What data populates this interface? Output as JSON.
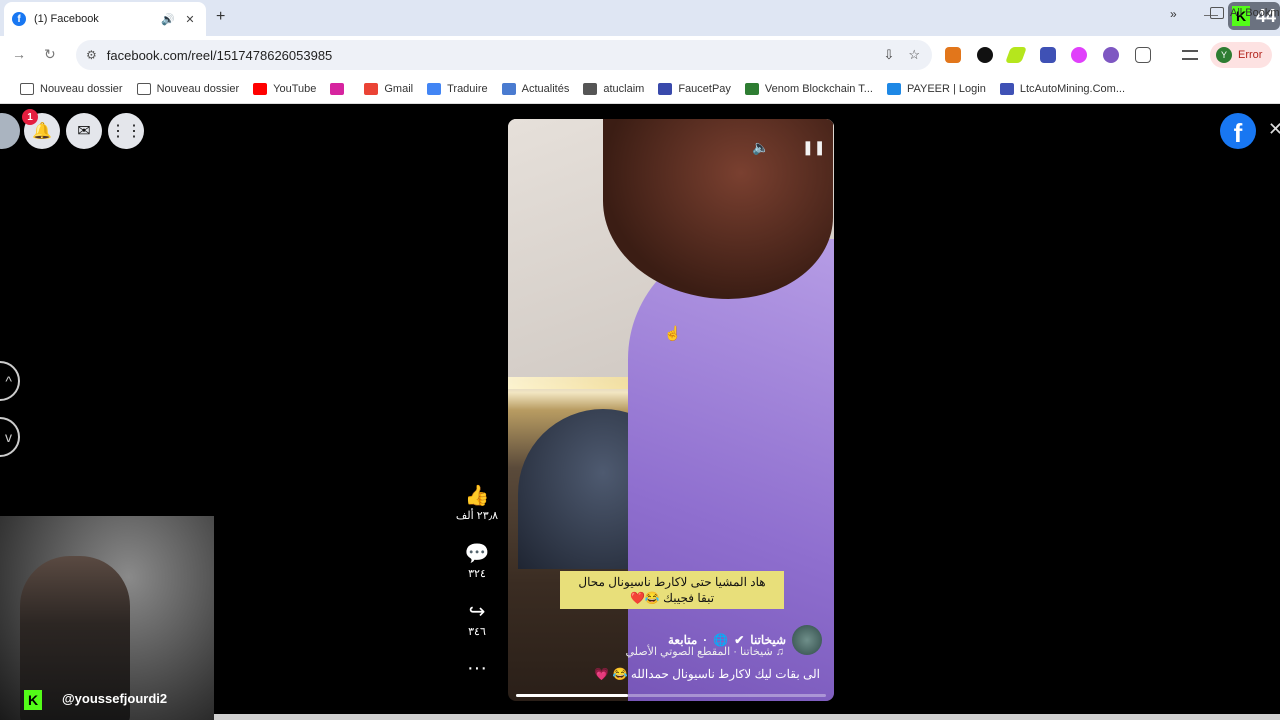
{
  "tab": {
    "title": "(1) Facebook",
    "audio_icon": "speaker-icon",
    "close": "✕"
  },
  "newtab": "+",
  "k_badge": {
    "k": "K",
    "count": "44"
  },
  "address": {
    "url": "facebook.com/reel/1517478626053985"
  },
  "profile": {
    "initial": "Y",
    "label": "Error"
  },
  "bookmarks": [
    {
      "label": "Nouveau dossier",
      "icon": "folder-icon",
      "color": ""
    },
    {
      "label": "Nouveau dossier",
      "icon": "folder-icon",
      "color": ""
    },
    {
      "label": "YouTube",
      "icon": "youtube-icon",
      "color": "#ff0000"
    },
    {
      "label": "",
      "icon": "instagram-icon",
      "color": "#d6249f"
    },
    {
      "label": "Gmail",
      "icon": "gmail-icon",
      "color": "#ea4335"
    },
    {
      "label": "Traduire",
      "icon": "translate-icon",
      "color": "#4285f4"
    },
    {
      "label": "Actualités",
      "icon": "news-icon",
      "color": "#4a7bd0"
    },
    {
      "label": "atuclaim",
      "icon": "globe-icon",
      "color": "#555555"
    },
    {
      "label": "FaucetPay",
      "icon": "faucetpay-icon",
      "color": "#3949ab"
    },
    {
      "label": "Venom Blockchain T...",
      "icon": "venom-icon",
      "color": "#2e7d32"
    },
    {
      "label": "PAYEER | Login",
      "icon": "payeer-icon",
      "color": "#1e88e5"
    },
    {
      "label": "LtcAutoMining.Com...",
      "icon": "ltc-icon",
      "color": "#3f51b5"
    }
  ],
  "bookmarks_more": "»",
  "all_bookmarks": "All Bookm",
  "fb": {
    "notif_count": "1",
    "logo": "f",
    "video": {
      "caption_line1": "هاد المشيا حتى لاكارط ناسيونال محال",
      "caption_line2": "تبقا فجيبك 😂❤️",
      "author": "شيخاتنا",
      "follow": "متابعة",
      "audio": "شيخاتنا · المقطع الصوتي الأصلي",
      "description": "الى بقات ليك لاكارط ناسيونال حمدالله 😂 💗",
      "progress": 0.36
    },
    "actions": {
      "likes": "٢٣٫٨ ألف",
      "comments": "٣٢٤",
      "shares": "٣٤٦"
    }
  },
  "stream": {
    "handle": "@youssefjourdi2",
    "k": "K"
  }
}
